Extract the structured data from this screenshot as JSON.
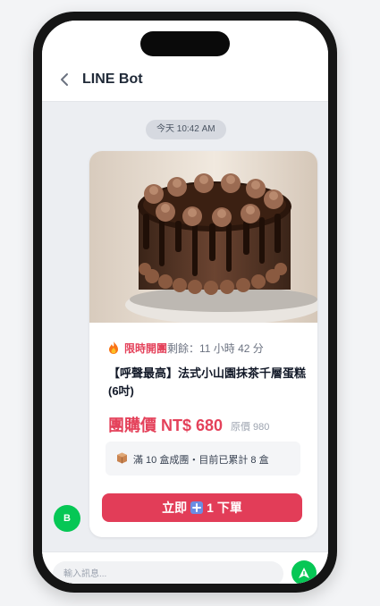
{
  "header": {
    "title": "LINE Bot",
    "back_icon": "chevron-left-icon"
  },
  "chat": {
    "timestamp": "今天 10:42 AM",
    "avatar_initial": "B"
  },
  "card": {
    "image_icon": "chocolate-cake-photo",
    "flash_icon": "fire-icon",
    "flash_label": "限時開團",
    "remaining": "剩餘：11 小時 42 分",
    "product_name": "【呼聲最高】法式小山園抹茶千層蛋糕 (6吋)",
    "group_price": "團購價 NT$ 680",
    "original_price": "原價 980",
    "progress_icon": "box-icon",
    "progress_text": "滿 10 盒成團・目前已累計 8 盒",
    "button": {
      "prefix": "立即",
      "icon": "plus-icon",
      "suffix": "1 下單"
    }
  },
  "composer": {
    "placeholder": "輸入訊息...",
    "send_icon": "send-icon"
  },
  "colors": {
    "accent_red": "#e23d58",
    "line_green": "#06c755",
    "phone_frame": "#151515"
  }
}
